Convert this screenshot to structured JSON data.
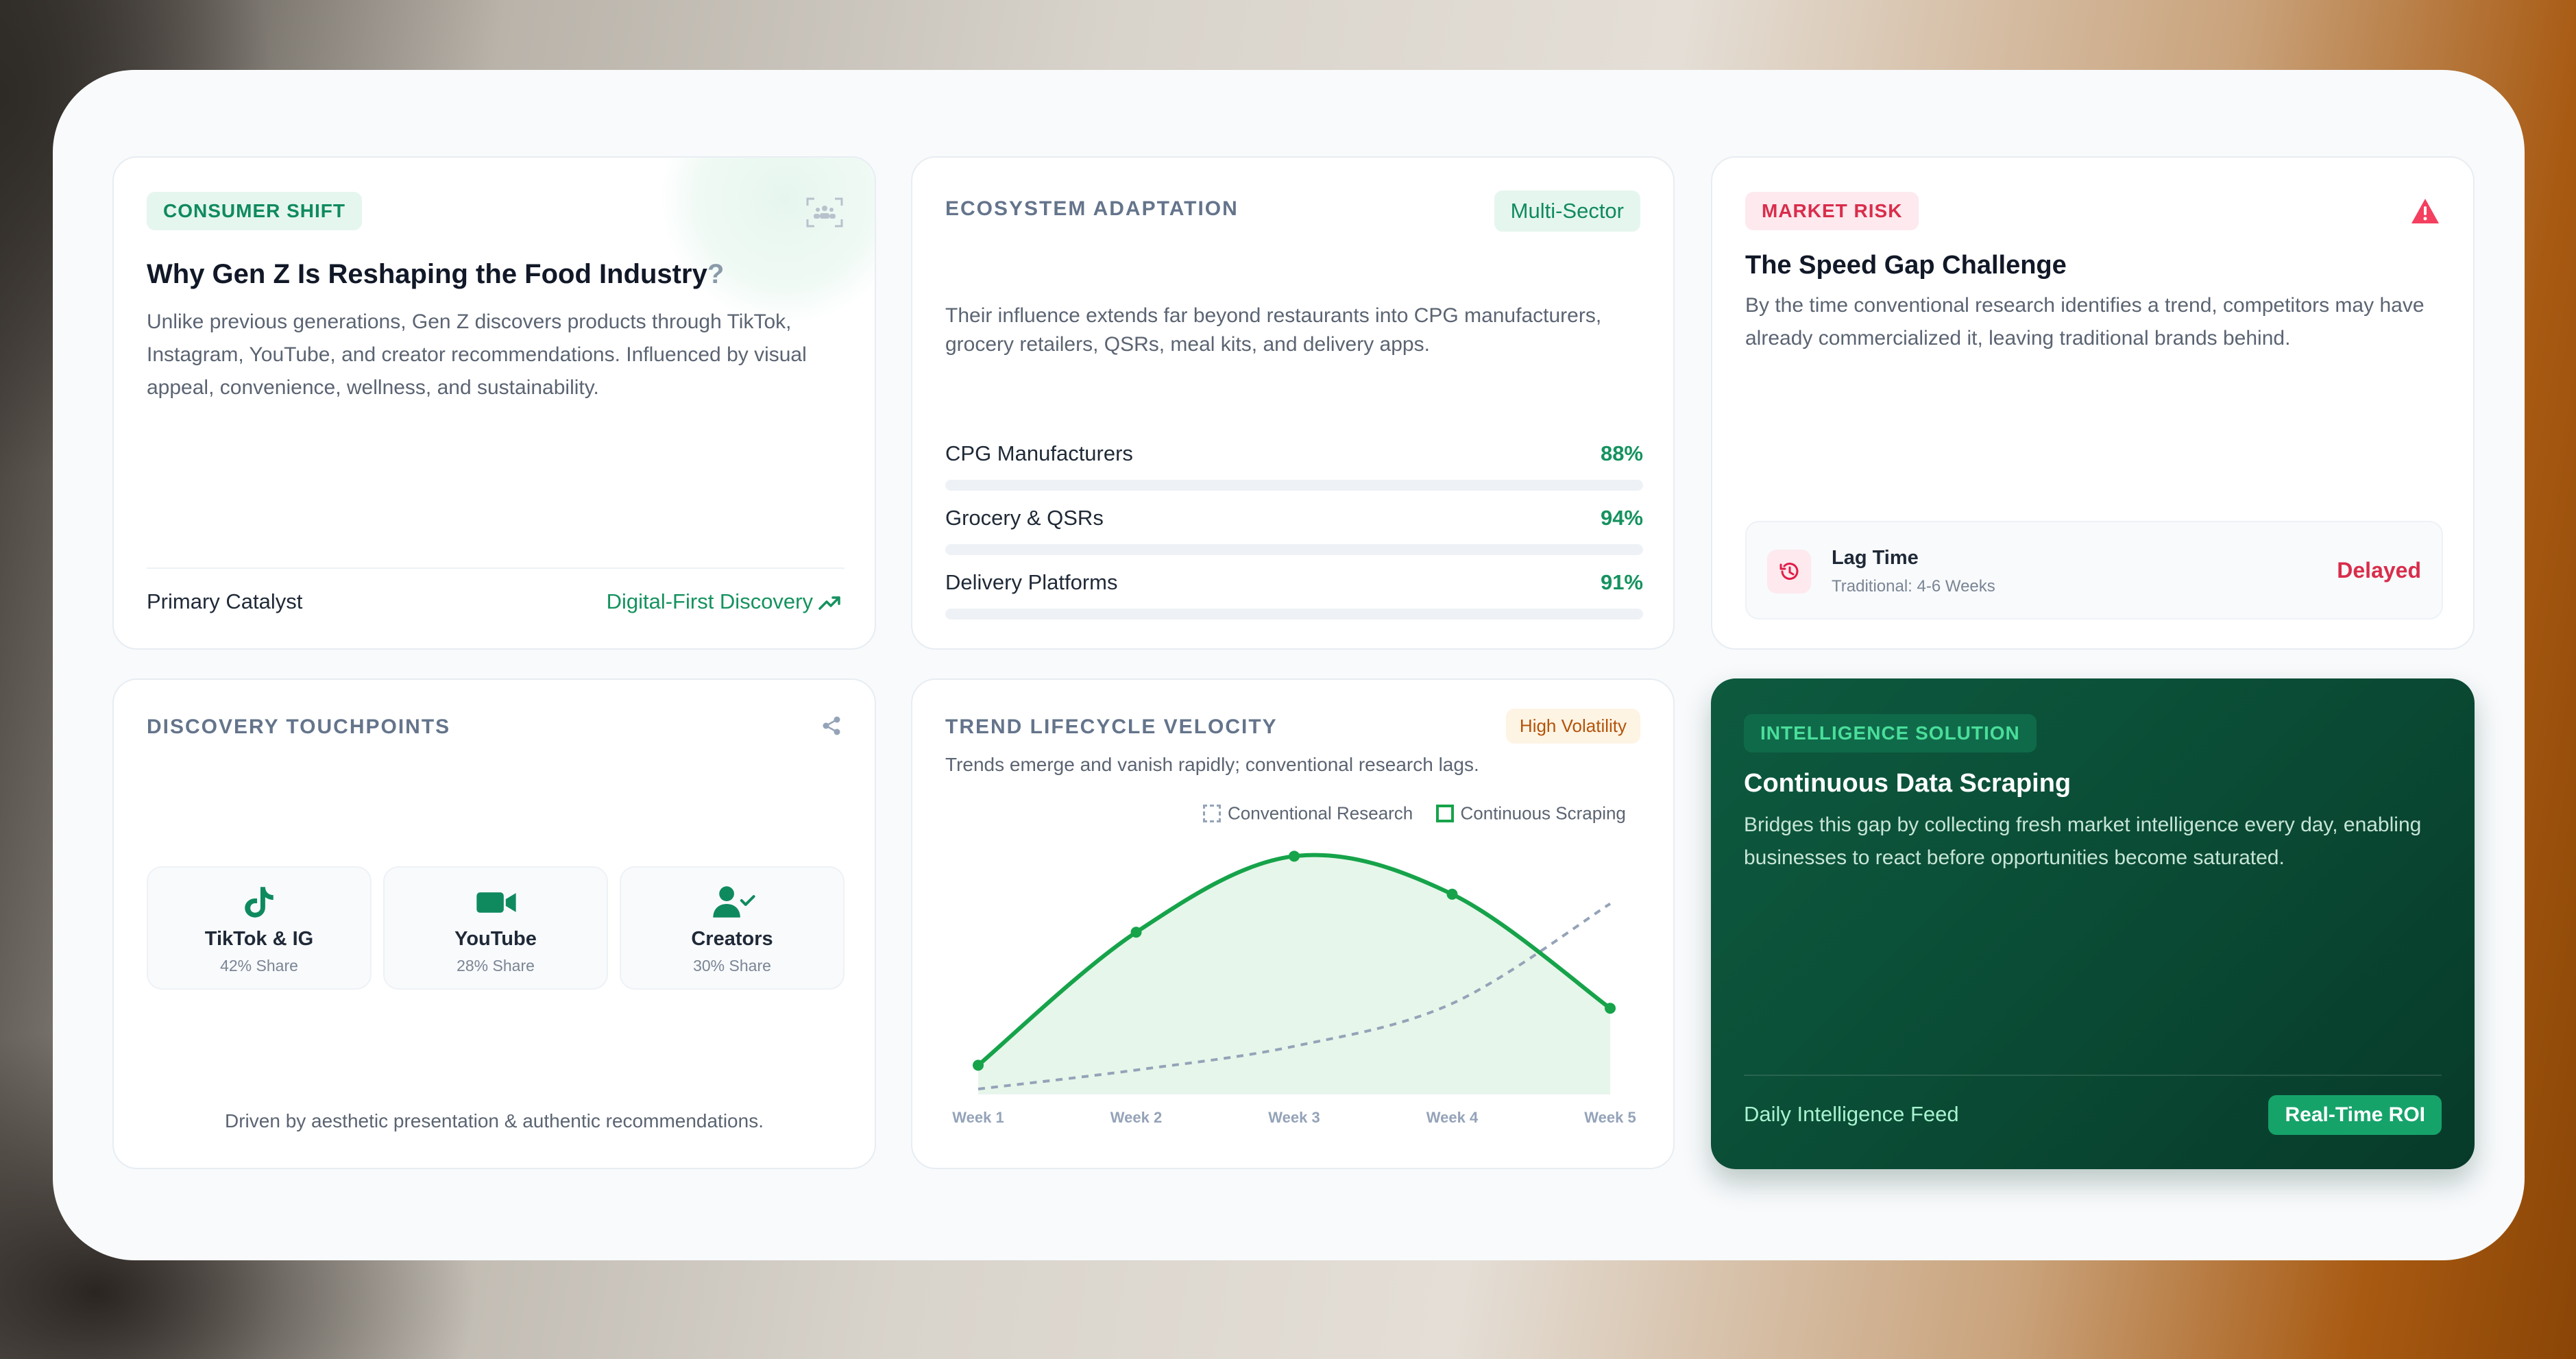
{
  "consumer_card": {
    "tag": "CONSUMER SHIFT",
    "title": "Why Gen Z Is Reshaping the Food Industry",
    "title_mark": "?",
    "body": "Unlike previous generations, Gen Z discovers products through TikTok, Instagram, YouTube, and creator recommendations. Influenced by visual appeal, convenience, wellness, and sustainability.",
    "footer_label": "Primary Catalyst",
    "footer_value": "Digital-First Discovery",
    "accent": "#15925f"
  },
  "ecosystem_card": {
    "label": "ECOSYSTEM ADAPTATION",
    "badge": "Multi-Sector",
    "body": "Their influence extends far beyond restaurants into CPG manufacturers, grocery retailers, QSRs, meal kits, and delivery apps.",
    "bars": [
      {
        "name": "CPG Manufacturers",
        "pct_label": "88%",
        "value": 88
      },
      {
        "name": "Grocery & QSRs",
        "pct_label": "94%",
        "value": 94
      },
      {
        "name": "Delivery Platforms",
        "pct_label": "91%",
        "value": 91
      }
    ]
  },
  "risk_card": {
    "tag": "MARKET RISK",
    "title": "The Speed Gap Challenge",
    "body": "By the time conventional research identifies a trend, competitors may have already commercialized it, leaving traditional brands behind.",
    "lag_title": "Lag Time",
    "lag_sub": "Traditional: 4-6 Weeks",
    "lag_status": "Delayed",
    "accent": "#d92d4b"
  },
  "touchpoints_card": {
    "label": "DISCOVERY TOUCHPOINTS",
    "items": [
      {
        "name": "TikTok & IG",
        "share": "42% Share",
        "icon": "tiktok-icon"
      },
      {
        "name": "YouTube",
        "share": "28% Share",
        "icon": "video-camera-icon"
      },
      {
        "name": "Creators",
        "share": "30% Share",
        "icon": "user-check-icon"
      }
    ],
    "note": "Driven by aesthetic presentation & authentic recommendations."
  },
  "trend_card": {
    "label": "TREND LIFECYCLE VELOCITY",
    "badge": "High Volatility",
    "body": "Trends emerge and vanish rapidly; conventional research lags.",
    "legend": [
      "Conventional Research",
      "Continuous Scraping"
    ]
  },
  "chart_data": {
    "type": "line",
    "categories": [
      "Week 1",
      "Week 2",
      "Week 3",
      "Week 4",
      "Week 5"
    ],
    "series": [
      {
        "name": "Conventional Research",
        "values": [
          2,
          10,
          20,
          38,
          80
        ],
        "color": "#94a3b8",
        "style": "dashed"
      },
      {
        "name": "Continuous Scraping",
        "values": [
          12,
          68,
          100,
          84,
          36
        ],
        "color": "#16a34a",
        "style": "solid-area"
      }
    ],
    "ylim": [
      0,
      105
    ],
    "grid": false,
    "legend_position": "top-right"
  },
  "solution_card": {
    "tag": "INTELLIGENCE SOLUTION",
    "title": "Continuous Data Scraping",
    "body": "Bridges this gap by collecting fresh market intelligence every day, enabling businesses to react before opportunities become saturated.",
    "feed_label": "Daily Intelligence Feed",
    "roi_label": "Real-Time ROI"
  }
}
